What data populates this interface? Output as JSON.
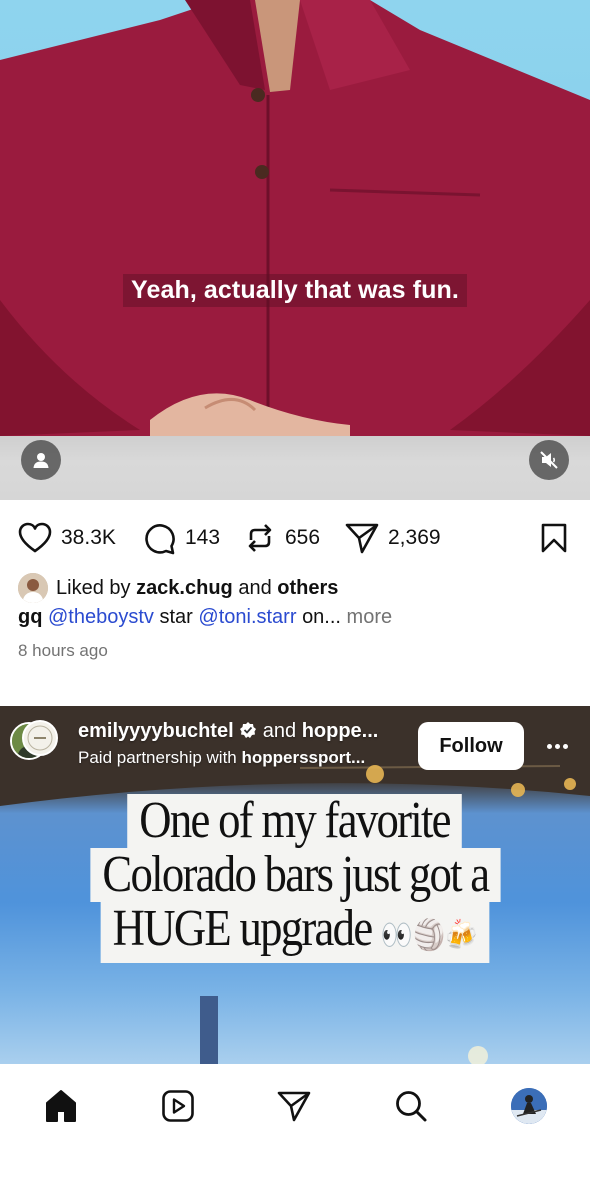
{
  "post1": {
    "subtitle": "Yeah, actually that was fun.",
    "likes": "38.3K",
    "comments": "143",
    "reposts": "656",
    "shares": "2,369",
    "liked_prefix": "Liked by",
    "liked_user": "zack.chug",
    "liked_and": "and",
    "liked_others": "others",
    "caption_user": "gq",
    "caption_mention1": "@theboystv",
    "caption_word": "star",
    "caption_mention2": "@toni.starr",
    "caption_tail": "on...",
    "caption_more": "more",
    "time_ago": "8 hours ago"
  },
  "post2": {
    "username": "emilyyyybuchtel",
    "and_text": "and",
    "coauthor": "hoppe...",
    "partner_prefix": "Paid partnership with",
    "partner_name": "hopperssport...",
    "follow_label": "Follow",
    "headline_line1": "One of my favorite",
    "headline_line2": "Colorado bars just got a",
    "headline_line3": "HUGE upgrade",
    "headline_emoji": "👀🏐🍻"
  },
  "colors": {
    "mention": "#2b4bd0",
    "muted": "#737373",
    "shirt": "#9a1b3e"
  },
  "nav": {
    "icons": [
      "home-icon",
      "reels-icon",
      "direct-message-icon",
      "search-icon",
      "profile-avatar"
    ]
  }
}
